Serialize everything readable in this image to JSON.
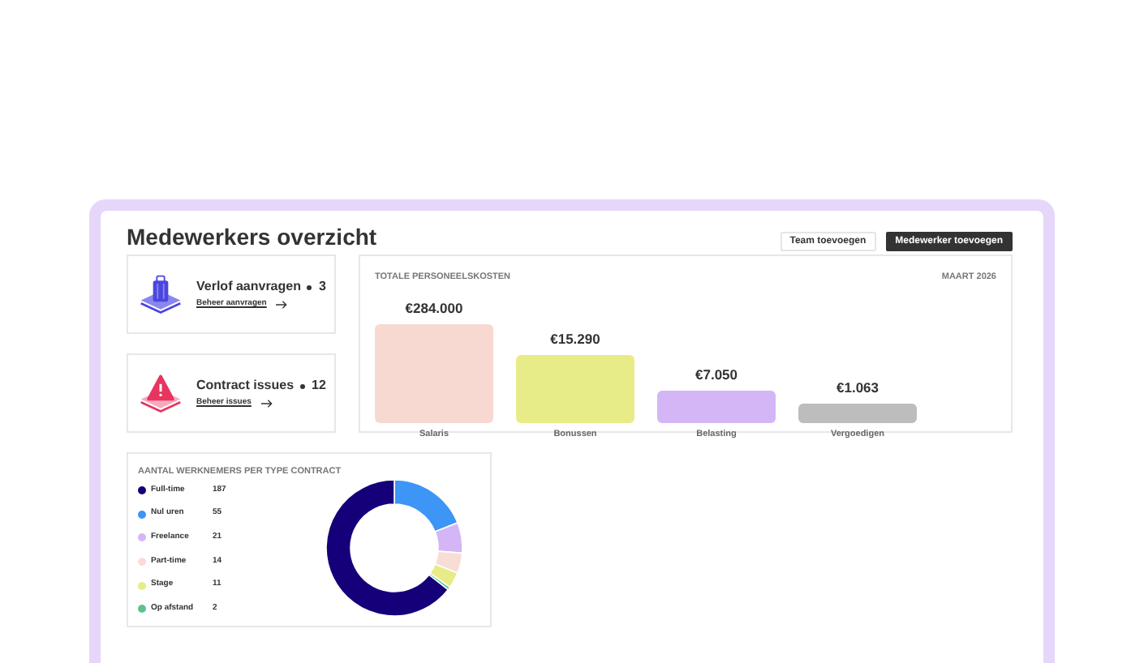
{
  "title": "Medewerkers overzicht",
  "buttons": [
    {
      "label": "Team toevoegen",
      "kind": "secondary"
    },
    {
      "label": "Medewerker toevoegen",
      "kind": "primary"
    }
  ],
  "cards": [
    {
      "kind": "leave",
      "title": "Verlof aanvragen",
      "count": "3",
      "link": "Beheer aanvragen"
    },
    {
      "kind": "warning",
      "title": "Contract issues",
      "count": "12",
      "link": "Beheer issues"
    }
  ],
  "costs": {
    "title": "TOTALE PERSONEELSKOSTEN",
    "period": "MAART 2026",
    "bars": [
      {
        "label": "Salaris",
        "amount": "€284.000",
        "color": "#f8d9d2"
      },
      {
        "label": "Bonussen",
        "amount": "€15.290",
        "color": "#e8ec88"
      },
      {
        "label": "Belasting",
        "amount": "€7.050",
        "color": "#d4b6f7"
      },
      {
        "label": "Vergoedigen",
        "amount": "€1.063",
        "color": "#bdbdbd"
      }
    ]
  },
  "contracts": {
    "title": "AANTAL WERKNEMERS PER TYPE CONTRACT",
    "legend": [
      {
        "label": "Full-time",
        "count": "187",
        "color": "#15007a"
      },
      {
        "label": "Nul uren",
        "count": "55",
        "color": "#3d95f5"
      },
      {
        "label": "Freelance",
        "count": "21",
        "color": "#d4b6f7"
      },
      {
        "label": "Part-time",
        "count": "14",
        "color": "#f8ddd6"
      },
      {
        "label": "Stage",
        "count": "11",
        "color": "#e8ec88"
      },
      {
        "label": "Op afstand",
        "count": "2",
        "color": "#5fc28a"
      }
    ]
  }
}
